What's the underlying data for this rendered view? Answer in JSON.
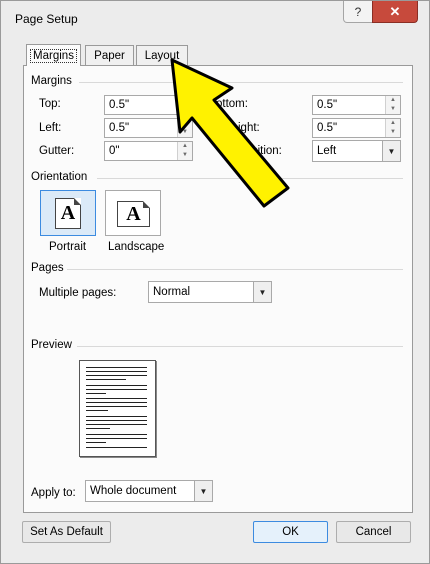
{
  "window": {
    "title": "Page Setup",
    "help_label": "?",
    "close_label": "✕"
  },
  "tabs": [
    {
      "label": "Margins",
      "active": true
    },
    {
      "label": "Paper",
      "active": false
    },
    {
      "label": "Layout",
      "active": false
    }
  ],
  "margins": {
    "section_label": "Margins",
    "top_label": "Top:",
    "top_value": "0.5\"",
    "left_label": "Left:",
    "left_value": "0.5\"",
    "gutter_label": "Gutter:",
    "gutter_value": "0\"",
    "bottom_label": "ottom:",
    "bottom_value": "0.5\"",
    "right_label": "ight:",
    "right_value": "0.5\"",
    "gutter_position_label": "r position:",
    "gutter_position_value": "Left"
  },
  "orientation": {
    "section_label": "Orientation",
    "portrait_label": "Portrait",
    "landscape_label": "Landscape",
    "icon_glyph": "A",
    "selected": "Portrait"
  },
  "pages": {
    "section_label": "Pages",
    "multiple_pages_label": "Multiple pages:",
    "multiple_pages_value": "Normal"
  },
  "preview": {
    "section_label": "Preview"
  },
  "apply": {
    "label": "Apply to:",
    "value": "Whole document"
  },
  "buttons": {
    "set_default": "Set As Default",
    "ok": "OK",
    "cancel": "Cancel"
  },
  "colors": {
    "arrow_fill": "#fff200",
    "arrow_outline": "#000000",
    "close_button": "#c74a3c",
    "selected_blue": "#3c8be0"
  }
}
